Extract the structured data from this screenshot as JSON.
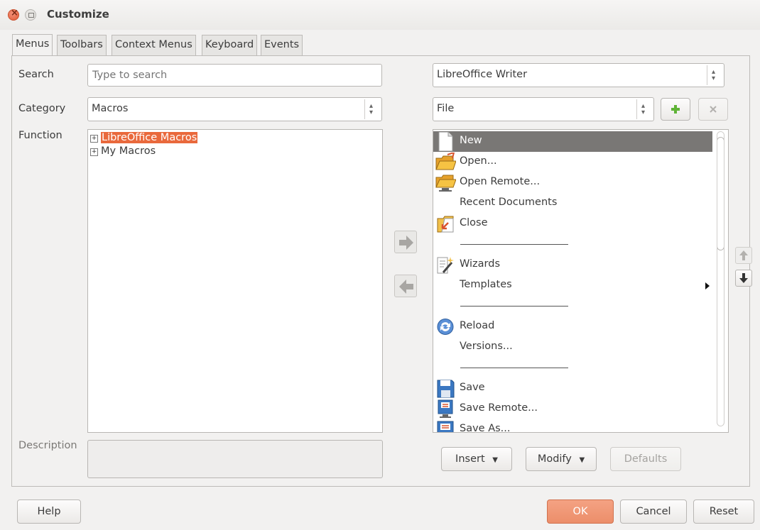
{
  "window": {
    "title": "Customize"
  },
  "tabs": [
    "Menus",
    "Toolbars",
    "Context Menus",
    "Keyboard",
    "Events"
  ],
  "left": {
    "search_label": "Search",
    "search_placeholder": "Type to search",
    "category_label": "Category",
    "category_value": "Macros",
    "function_label": "Function",
    "functions": [
      "LibreOffice Macros",
      "My Macros"
    ],
    "description_label": "Description"
  },
  "right": {
    "scope_value": "LibreOffice Writer",
    "menu_value": "File",
    "entries": [
      {
        "label": "New",
        "icon": "new-document-icon"
      },
      {
        "label": "Open...",
        "icon": "open-folder-icon"
      },
      {
        "label": "Open Remote...",
        "icon": "open-remote-icon"
      },
      {
        "label": "Recent Documents",
        "icon": ""
      },
      {
        "label": "Close",
        "icon": "close-document-icon"
      },
      {
        "label": "-----------------------------------",
        "icon": ""
      },
      {
        "label": "Wizards",
        "icon": "wizards-icon"
      },
      {
        "label": "Templates",
        "icon": ""
      },
      {
        "label": "-----------------------------------",
        "icon": ""
      },
      {
        "label": "Reload",
        "icon": "reload-icon"
      },
      {
        "label": "Versions...",
        "icon": ""
      },
      {
        "label": "-----------------------------------",
        "icon": ""
      },
      {
        "label": "Save",
        "icon": "save-icon"
      },
      {
        "label": "Save Remote...",
        "icon": "save-remote-icon"
      },
      {
        "label": "Save As...",
        "icon": "save-as-icon"
      }
    ],
    "insert_label": "Insert",
    "modify_label": "Modify",
    "defaults_label": "Defaults"
  },
  "footer": {
    "help": "Help",
    "ok": "OK",
    "cancel": "Cancel",
    "reset": "Reset"
  },
  "colors": {
    "accent": "#e9693c",
    "selection": "#797775",
    "ok_button": "#ee9676"
  }
}
